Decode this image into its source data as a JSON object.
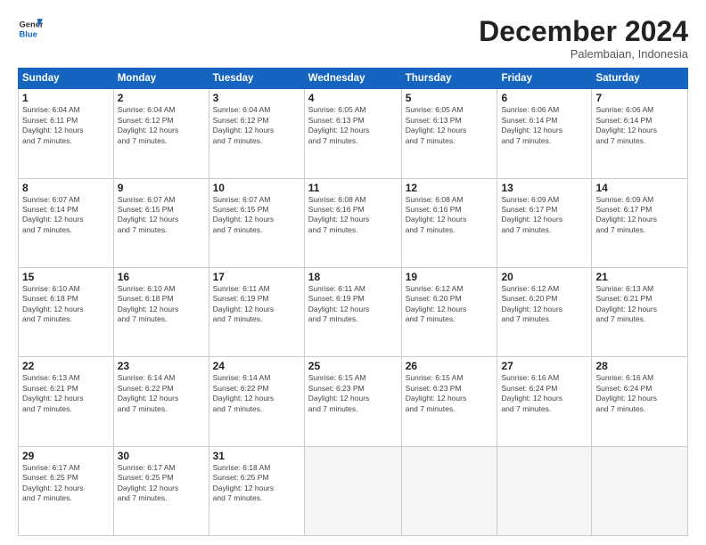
{
  "header": {
    "logo_line1": "General",
    "logo_line2": "Blue",
    "month": "December 2024",
    "location": "Palembaian, Indonesia"
  },
  "weekdays": [
    "Sunday",
    "Monday",
    "Tuesday",
    "Wednesday",
    "Thursday",
    "Friday",
    "Saturday"
  ],
  "weeks": [
    [
      {
        "day": "1",
        "info": "Sunrise: 6:04 AM\nSunset: 6:11 PM\nDaylight: 12 hours\nand 7 minutes."
      },
      {
        "day": "2",
        "info": "Sunrise: 6:04 AM\nSunset: 6:12 PM\nDaylight: 12 hours\nand 7 minutes."
      },
      {
        "day": "3",
        "info": "Sunrise: 6:04 AM\nSunset: 6:12 PM\nDaylight: 12 hours\nand 7 minutes."
      },
      {
        "day": "4",
        "info": "Sunrise: 6:05 AM\nSunset: 6:13 PM\nDaylight: 12 hours\nand 7 minutes."
      },
      {
        "day": "5",
        "info": "Sunrise: 6:05 AM\nSunset: 6:13 PM\nDaylight: 12 hours\nand 7 minutes."
      },
      {
        "day": "6",
        "info": "Sunrise: 6:06 AM\nSunset: 6:14 PM\nDaylight: 12 hours\nand 7 minutes."
      },
      {
        "day": "7",
        "info": "Sunrise: 6:06 AM\nSunset: 6:14 PM\nDaylight: 12 hours\nand 7 minutes."
      }
    ],
    [
      {
        "day": "8",
        "info": "Sunrise: 6:07 AM\nSunset: 6:14 PM\nDaylight: 12 hours\nand 7 minutes."
      },
      {
        "day": "9",
        "info": "Sunrise: 6:07 AM\nSunset: 6:15 PM\nDaylight: 12 hours\nand 7 minutes."
      },
      {
        "day": "10",
        "info": "Sunrise: 6:07 AM\nSunset: 6:15 PM\nDaylight: 12 hours\nand 7 minutes."
      },
      {
        "day": "11",
        "info": "Sunrise: 6:08 AM\nSunset: 6:16 PM\nDaylight: 12 hours\nand 7 minutes."
      },
      {
        "day": "12",
        "info": "Sunrise: 6:08 AM\nSunset: 6:16 PM\nDaylight: 12 hours\nand 7 minutes."
      },
      {
        "day": "13",
        "info": "Sunrise: 6:09 AM\nSunset: 6:17 PM\nDaylight: 12 hours\nand 7 minutes."
      },
      {
        "day": "14",
        "info": "Sunrise: 6:09 AM\nSunset: 6:17 PM\nDaylight: 12 hours\nand 7 minutes."
      }
    ],
    [
      {
        "day": "15",
        "info": "Sunrise: 6:10 AM\nSunset: 6:18 PM\nDaylight: 12 hours\nand 7 minutes."
      },
      {
        "day": "16",
        "info": "Sunrise: 6:10 AM\nSunset: 6:18 PM\nDaylight: 12 hours\nand 7 minutes."
      },
      {
        "day": "17",
        "info": "Sunrise: 6:11 AM\nSunset: 6:19 PM\nDaylight: 12 hours\nand 7 minutes."
      },
      {
        "day": "18",
        "info": "Sunrise: 6:11 AM\nSunset: 6:19 PM\nDaylight: 12 hours\nand 7 minutes."
      },
      {
        "day": "19",
        "info": "Sunrise: 6:12 AM\nSunset: 6:20 PM\nDaylight: 12 hours\nand 7 minutes."
      },
      {
        "day": "20",
        "info": "Sunrise: 6:12 AM\nSunset: 6:20 PM\nDaylight: 12 hours\nand 7 minutes."
      },
      {
        "day": "21",
        "info": "Sunrise: 6:13 AM\nSunset: 6:21 PM\nDaylight: 12 hours\nand 7 minutes."
      }
    ],
    [
      {
        "day": "22",
        "info": "Sunrise: 6:13 AM\nSunset: 6:21 PM\nDaylight: 12 hours\nand 7 minutes."
      },
      {
        "day": "23",
        "info": "Sunrise: 6:14 AM\nSunset: 6:22 PM\nDaylight: 12 hours\nand 7 minutes."
      },
      {
        "day": "24",
        "info": "Sunrise: 6:14 AM\nSunset: 6:22 PM\nDaylight: 12 hours\nand 7 minutes."
      },
      {
        "day": "25",
        "info": "Sunrise: 6:15 AM\nSunset: 6:23 PM\nDaylight: 12 hours\nand 7 minutes."
      },
      {
        "day": "26",
        "info": "Sunrise: 6:15 AM\nSunset: 6:23 PM\nDaylight: 12 hours\nand 7 minutes."
      },
      {
        "day": "27",
        "info": "Sunrise: 6:16 AM\nSunset: 6:24 PM\nDaylight: 12 hours\nand 7 minutes."
      },
      {
        "day": "28",
        "info": "Sunrise: 6:16 AM\nSunset: 6:24 PM\nDaylight: 12 hours\nand 7 minutes."
      }
    ],
    [
      {
        "day": "29",
        "info": "Sunrise: 6:17 AM\nSunset: 6:25 PM\nDaylight: 12 hours\nand 7 minutes."
      },
      {
        "day": "30",
        "info": "Sunrise: 6:17 AM\nSunset: 6:25 PM\nDaylight: 12 hours\nand 7 minutes."
      },
      {
        "day": "31",
        "info": "Sunrise: 6:18 AM\nSunset: 6:25 PM\nDaylight: 12 hours\nand 7 minutes."
      },
      {
        "day": "",
        "info": ""
      },
      {
        "day": "",
        "info": ""
      },
      {
        "day": "",
        "info": ""
      },
      {
        "day": "",
        "info": ""
      }
    ]
  ]
}
